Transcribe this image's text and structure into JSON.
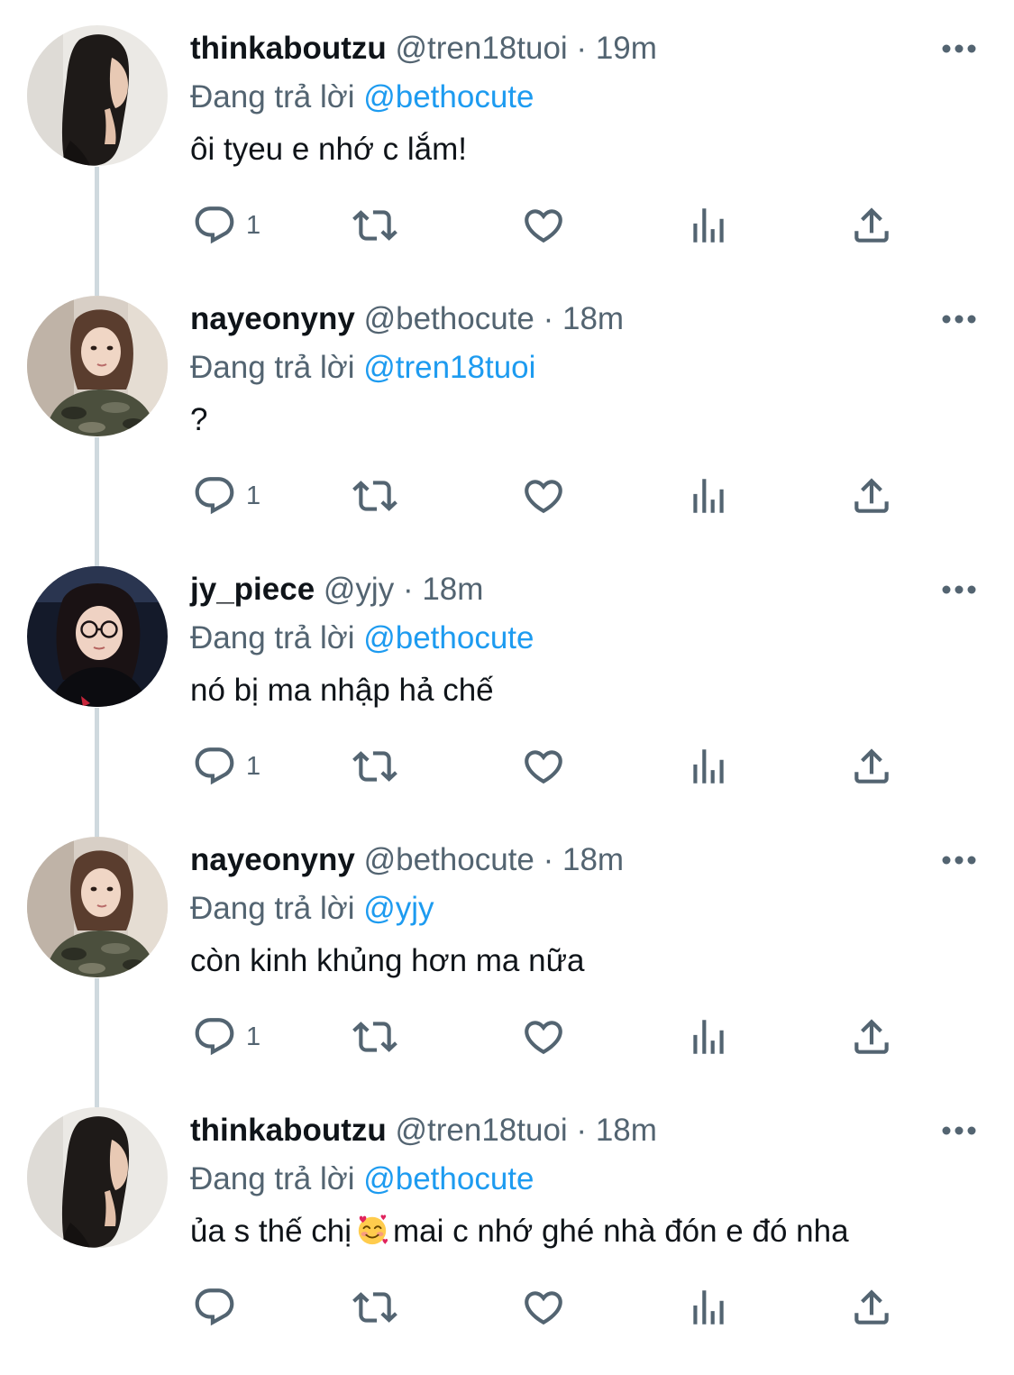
{
  "tweets": [
    {
      "display_name": "thinkaboutzu",
      "handle": "@tren18tuoi",
      "separator": "·",
      "time": "19m",
      "reply_prefix": "Đang trả lời",
      "reply_to": "@bethocute",
      "text": "ôi tyeu e nhớ c lắm!",
      "reply_count": "1",
      "avatar": "avatar-long-hair-profile"
    },
    {
      "display_name": "nayeonyny",
      "handle": "@bethocute",
      "separator": "·",
      "time": "18m",
      "reply_prefix": "Đang trả lời",
      "reply_to": "@tren18tuoi",
      "text": "?",
      "reply_count": "1",
      "avatar": "avatar-camo-shirt-selfie"
    },
    {
      "display_name": "jy_piece",
      "handle": "@yjy",
      "separator": "·",
      "time": "18m",
      "reply_prefix": "Đang trả lời",
      "reply_to": "@bethocute",
      "text": "nó bị ma nhập hả chế",
      "reply_count": "1",
      "avatar": "avatar-glasses-dark-background"
    },
    {
      "display_name": "nayeonyny",
      "handle": "@bethocute",
      "separator": "·",
      "time": "18m",
      "reply_prefix": "Đang trả lời",
      "reply_to": "@yjy",
      "text": "còn kinh khủng hơn ma nữa",
      "reply_count": "1",
      "avatar": "avatar-camo-shirt-selfie"
    },
    {
      "display_name": "thinkaboutzu",
      "handle": "@tren18tuoi",
      "separator": "·",
      "time": "18m",
      "reply_prefix": "Đang trả lời",
      "reply_to": "@bethocute",
      "text_before_emoji": "ủa s thế chị",
      "emoji": "smiling-face-with-hearts",
      "text_after_emoji": "mai c nhớ ghé nhà đón e đó nha",
      "reply_count": "",
      "avatar": "avatar-long-hair-profile"
    }
  ],
  "icons": {
    "more": "more-horizontal-icon",
    "reply": "reply-bubble-icon",
    "retweet": "retweet-icon",
    "like": "heart-icon",
    "views": "views-bar-chart-icon",
    "share": "share-upload-icon"
  },
  "colors": {
    "text_primary": "#0f1419",
    "text_secondary": "#536471",
    "link": "#1d9bf0",
    "thread_line": "#cfd9de",
    "background": "#ffffff"
  }
}
